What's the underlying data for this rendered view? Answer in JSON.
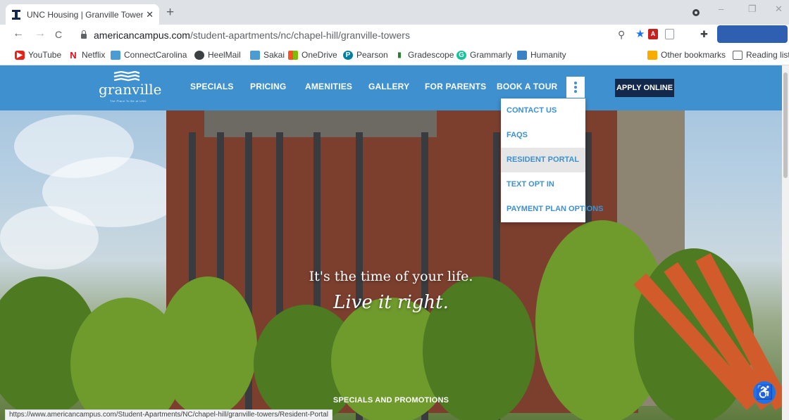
{
  "browser": {
    "tab": {
      "title": "UNC Housing | Granville Towers",
      "close": "✕"
    },
    "new_tab": "+",
    "window_controls": {
      "minimize": "–",
      "restore": "❐",
      "close": "✕"
    },
    "nav": {
      "back": "←",
      "forward": "→",
      "reload": "C"
    },
    "url": {
      "host": "americancampus.com",
      "path": "/student-apartments/nc/chapel-hill/granville-towers"
    },
    "status_url": "https://www.americancampus.com/Student-Apartments/NC/chapel-hill/granville-towers/Resident-Portal"
  },
  "bookmarks": [
    {
      "label": "YouTube",
      "icon": "youtube-icon",
      "color": "#e62117"
    },
    {
      "label": "Netflix",
      "icon": "netflix-icon",
      "color": "#e50914"
    },
    {
      "label": "ConnectCarolina",
      "icon": "connectcarolina-icon",
      "color": "#4b9cd3"
    },
    {
      "label": "HeelMail",
      "icon": "heelmail-icon",
      "color": "#3c4043"
    },
    {
      "label": "Sakai",
      "icon": "sakai-icon",
      "color": "#4b9cd3"
    },
    {
      "label": "OneDrive",
      "icon": "onedrive-icon",
      "color": "#f35325"
    },
    {
      "label": "Pearson",
      "icon": "pearson-icon",
      "color": "#007fa3"
    },
    {
      "label": "Gradescope",
      "icon": "gradescope-icon",
      "color": "#2e7d32"
    },
    {
      "label": "Grammarly",
      "icon": "grammarly-icon",
      "color": "#15c39a"
    },
    {
      "label": "Humanity",
      "icon": "humanity-icon",
      "color": "#3b82c4"
    },
    {
      "label": "Other bookmarks",
      "icon": "folder-icon",
      "color": "#f9ab00"
    },
    {
      "label": "Reading list",
      "icon": "reading-list-icon",
      "color": "#5f6368"
    }
  ],
  "site": {
    "logo": {
      "word": "granville",
      "tagline": "The Place To Be at UNC"
    },
    "nav": [
      "SPECIALS",
      "PRICING",
      "AMENITIES",
      "GALLERY",
      "FOR PARENTS",
      "BOOK A TOUR"
    ],
    "apply": "APPLY ONLINE",
    "dropdown": [
      "CONTACT US",
      "FAQS",
      "RESIDENT PORTAL",
      "TEXT OPT IN",
      "PAYMENT PLAN OPTIONS"
    ],
    "dropdown_hover_index": 2,
    "hero": {
      "line1": "It's the time of your life.",
      "line2": "Live it right.",
      "specials_label": "SPECIALS AND PROMOTIONS"
    },
    "colors": {
      "nav_bg": "#3e90cf",
      "apply_bg": "#13294b",
      "accessibility": "#1e73e8"
    }
  }
}
